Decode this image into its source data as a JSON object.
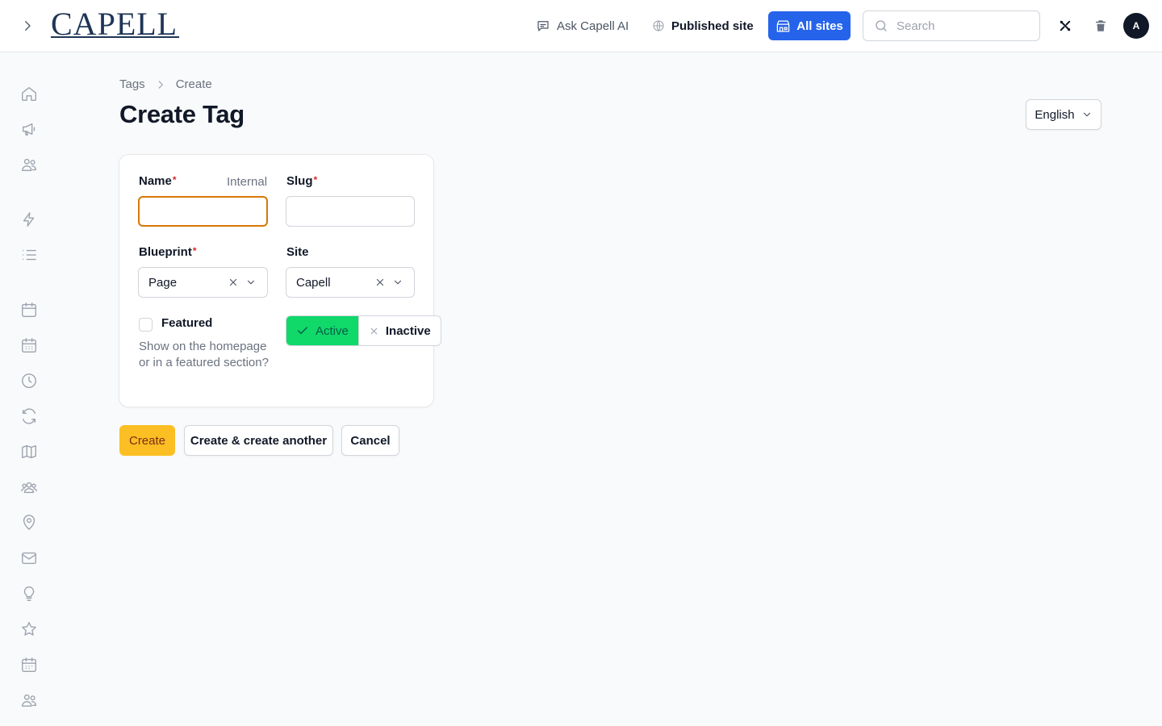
{
  "header": {
    "logo_text": "CAPELL",
    "ask_ai_label": "Ask Capell AI",
    "published_site_label": "Published site",
    "all_sites_label": "All sites",
    "search_placeholder": "Search",
    "avatar_initial": "A"
  },
  "sidebar": {
    "icons": [
      "home-icon",
      "megaphone-icon",
      "users-icon",
      "lightning-icon",
      "list-icon",
      "calendar-icon",
      "calendar-grid-icon",
      "clock-icon",
      "refresh-icon",
      "map-icon",
      "user-group-icon",
      "map-pin-icon",
      "envelope-icon",
      "lightbulb-icon",
      "star-icon",
      "calendar-days-icon",
      "users-icon"
    ]
  },
  "breadcrumb": {
    "parent": "Tags",
    "current": "Create"
  },
  "page": {
    "title": "Create Tag",
    "language": "English"
  },
  "form": {
    "name": {
      "label": "Name",
      "required_mark": "*",
      "hint": "Internal",
      "value": ""
    },
    "slug": {
      "label": "Slug",
      "required_mark": "*",
      "value": ""
    },
    "blueprint": {
      "label": "Blueprint",
      "required_mark": "*",
      "value": "Page"
    },
    "site": {
      "label": "Site",
      "value": "Capell"
    },
    "featured": {
      "label": "Featured",
      "help": "Show on the homepage or in a featured section?",
      "checked": false
    },
    "status": {
      "active_label": "Active",
      "inactive_label": "Inactive",
      "selected": "Active"
    }
  },
  "actions": {
    "create_label": "Create",
    "create_another_label": "Create & create another",
    "cancel_label": "Cancel"
  },
  "colors": {
    "primary": "#fbbf24",
    "brand_blue": "#2563eb",
    "active_green": "#10d96a",
    "focus_ring": "#d97706"
  }
}
